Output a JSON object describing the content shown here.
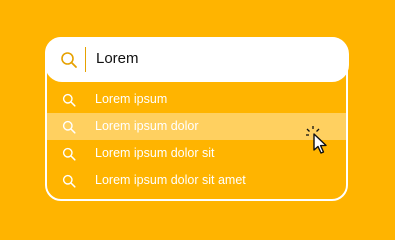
{
  "search": {
    "query": "Lorem"
  },
  "suggestions": [
    {
      "label": "Lorem ipsum"
    },
    {
      "label": "Lorem ipsum dolor"
    },
    {
      "label": "Lorem ipsum dolor sit"
    },
    {
      "label": "Lorem ipsum dolor sit amet"
    }
  ],
  "colors": {
    "background": "#ffb400",
    "highlight": "#ffd060",
    "accent": "#e6a100",
    "text_light": "#ffffff",
    "text_dark": "#111111"
  },
  "icons": {
    "search": "search-icon",
    "cursor": "mouse-pointer-icon"
  }
}
